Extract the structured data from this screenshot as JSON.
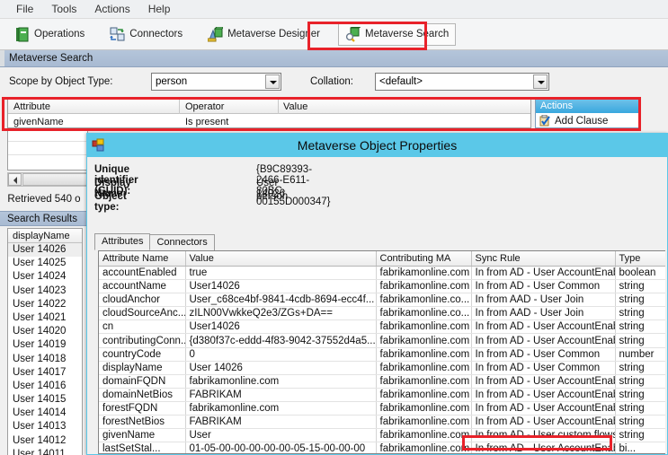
{
  "menubar": {
    "items": [
      {
        "label": "File"
      },
      {
        "label": "Tools"
      },
      {
        "label": "Actions"
      },
      {
        "label": "Help"
      }
    ]
  },
  "toolbar": {
    "buttons": [
      {
        "label": "Operations",
        "icon": "operations-icon",
        "pressed": false
      },
      {
        "label": "Connectors",
        "icon": "connectors-icon",
        "pressed": false
      },
      {
        "label": "Metaverse Designer",
        "icon": "metaverse-designer-icon",
        "pressed": false
      },
      {
        "label": "Metaverse Search",
        "icon": "metaverse-search-icon",
        "pressed": true
      }
    ]
  },
  "section": {
    "title": "Metaverse Search"
  },
  "scope": {
    "object_type_label": "Scope by Object Type:",
    "object_type_value": "person",
    "collation_label": "Collation:",
    "collation_value": "<default>"
  },
  "clause_grid": {
    "headers": [
      "Attribute",
      "Operator",
      "Value"
    ],
    "rows": [
      {
        "attribute": "givenName",
        "operator": "Is present",
        "value": ""
      }
    ]
  },
  "actions_pane": {
    "title": "Actions",
    "items": [
      {
        "label": "Add Clause",
        "icon": "add-clause-icon"
      }
    ]
  },
  "left_pane": {
    "retrieved_text": "Retrieved 540 o",
    "search_results_title": "Search Results",
    "results_column_header": "displayName",
    "results": [
      "User 14026",
      "User 14025",
      "User 14024",
      "User 14023",
      "User 14022",
      "User 14021",
      "User 14020",
      "User 14019",
      "User 14018",
      "User 14017",
      "User 14016",
      "User 14015",
      "User 14014",
      "User 14013",
      "User 14012",
      "User 14011"
    ],
    "selected_index": 0
  },
  "dialog": {
    "title": "Metaverse Object Properties",
    "icon": "object-properties-icon",
    "info": [
      {
        "key": "Unique identifier (GUID):",
        "value": "{B9C89393-2466-E611-80BC-00155D000347}"
      },
      {
        "key": "Display Name:",
        "value": "User 14026"
      },
      {
        "key": "Object type:",
        "value": "person"
      }
    ],
    "tabs": [
      {
        "label": "Attributes",
        "active": true
      },
      {
        "label": "Connectors",
        "active": false
      }
    ],
    "grid": {
      "headers": [
        "Attribute Name",
        "Value",
        "Contributing MA",
        "Sync Rule",
        "Type"
      ],
      "rows": [
        [
          "accountEnabled",
          "true",
          "fabrikamonline.com",
          "In from AD - User AccountEnabled",
          "boolean"
        ],
        [
          "accountName",
          "User14026",
          "fabrikamonline.com",
          "In from AD - User Common",
          "string"
        ],
        [
          "cloudAnchor",
          "User_c68ce4bf-9841-4cdb-8694-ecc4f...",
          "fabrikamonline.co...",
          "In from AAD - User Join",
          "string"
        ],
        [
          "cloudSourceAnc...",
          "zILN00VwkkeQ2e3/ZGs+DA==",
          "fabrikamonline.co...",
          "In from AAD - User Join",
          "string"
        ],
        [
          "cn",
          "User14026",
          "fabrikamonline.com",
          "In from AD - User AccountEnabled",
          "string"
        ],
        [
          "contributingConn...",
          "{d380f37c-eddd-4f83-9042-37552d4a5...",
          "fabrikamonline.com",
          "In from AD - User AccountEnabled",
          "string"
        ],
        [
          "countryCode",
          "0",
          "fabrikamonline.com",
          "In from AD - User Common",
          "number"
        ],
        [
          "displayName",
          "User 14026",
          "fabrikamonline.com",
          "In from AD - User Common",
          "string"
        ],
        [
          "domainFQDN",
          "fabrikamonline.com",
          "fabrikamonline.com",
          "In from AD - User AccountEnabled",
          "string"
        ],
        [
          "domainNetBios",
          "FABRIKAM",
          "fabrikamonline.com",
          "In from AD - User AccountEnabled",
          "string"
        ],
        [
          "forestFQDN",
          "fabrikamonline.com",
          "fabrikamonline.com",
          "In from AD - User AccountEnabled",
          "string"
        ],
        [
          "forestNetBios",
          "FABRIKAM",
          "fabrikamonline.com",
          "In from AD - User AccountEnabled",
          "string"
        ],
        [
          "givenName",
          "User",
          "fabrikamonline.com",
          "In from AD - User custom flows",
          "string"
        ],
        [
          "lastSetStal...",
          "01-05-00-00-00-00-00-05-15-00-00-00",
          "fabrikamonline.com",
          "In from AD - User AccountEnabled",
          "bi..."
        ]
      ],
      "highlighted_cell": {
        "row": 12,
        "col": 3
      }
    }
  },
  "annotations": {
    "accent_red": "#e8222a",
    "boxes": [
      {
        "name": "metaverse-search-toolbar-highlight"
      },
      {
        "name": "clause-grid-highlight"
      },
      {
        "name": "sync-rule-cell-highlight"
      }
    ]
  }
}
